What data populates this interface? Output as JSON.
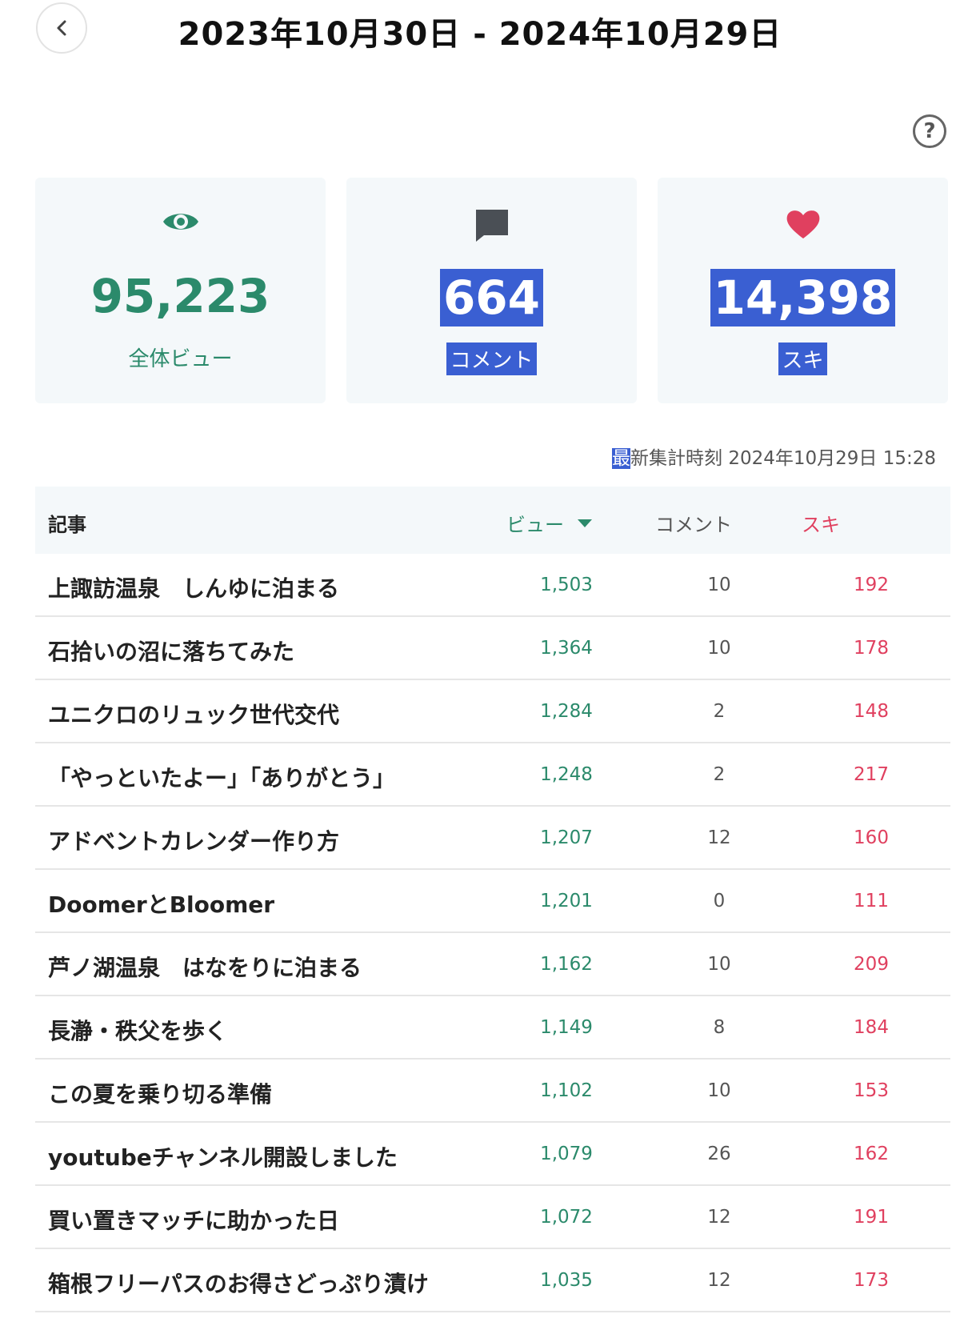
{
  "header": {
    "date_range": "2023年10月30日 - 2024年10月29日"
  },
  "help": {
    "label": "?"
  },
  "stats": {
    "views": {
      "value": "95,223",
      "label": "全体ビュー",
      "icon": "eye-icon",
      "color": "#2b8a6b"
    },
    "comments": {
      "value": "664",
      "label": "コメント",
      "icon": "comment-icon",
      "color": "#4a4f55"
    },
    "likes": {
      "value": "14,398",
      "label": "スキ",
      "icon": "heart-icon",
      "color": "#e0405f"
    }
  },
  "updated": {
    "first_char": "最",
    "rest": "新集計時刻 2024年10月29日 15:28"
  },
  "table": {
    "headers": {
      "article": "記事",
      "views": "ビュー",
      "comments": "コメント",
      "likes": "スキ"
    },
    "rows": [
      {
        "title": "上諏訪温泉　しんゆに泊まる",
        "views": "1,503",
        "comments": "10",
        "likes": "192"
      },
      {
        "title": "石拾いの沼に落ちてみた",
        "views": "1,364",
        "comments": "10",
        "likes": "178"
      },
      {
        "title": "ユニクロのリュック世代交代",
        "views": "1,284",
        "comments": "2",
        "likes": "148"
      },
      {
        "title": "「やっといたよー」「ありがとう」",
        "views": "1,248",
        "comments": "2",
        "likes": "217"
      },
      {
        "title": "アドベントカレンダー作り方",
        "views": "1,207",
        "comments": "12",
        "likes": "160"
      },
      {
        "title": "DoomerとBloomer",
        "views": "1,201",
        "comments": "0",
        "likes": "111"
      },
      {
        "title": "芦ノ湖温泉　はなをりに泊まる",
        "views": "1,162",
        "comments": "10",
        "likes": "209"
      },
      {
        "title": "長瀞・秩父を歩く",
        "views": "1,149",
        "comments": "8",
        "likes": "184"
      },
      {
        "title": "この夏を乗り切る準備",
        "views": "1,102",
        "comments": "10",
        "likes": "153"
      },
      {
        "title": "youtubeチャンネル開設しました",
        "views": "1,079",
        "comments": "26",
        "likes": "162"
      },
      {
        "title": "買い置きマッチに助かった日",
        "views": "1,072",
        "comments": "12",
        "likes": "191"
      },
      {
        "title": "箱根フリーパスのお得さどっぷり漬け",
        "views": "1,035",
        "comments": "12",
        "likes": "173"
      }
    ]
  }
}
